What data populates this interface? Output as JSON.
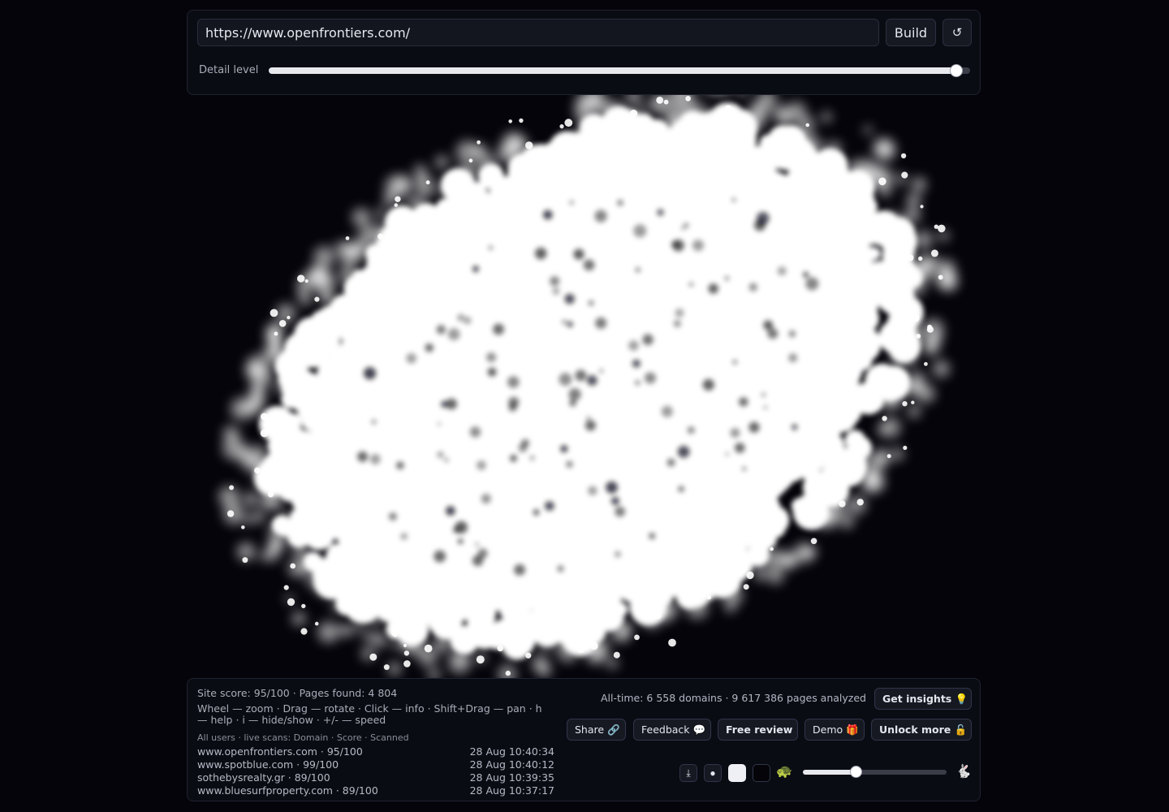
{
  "url_bar": {
    "value": "https://www.openfrontiers.com/",
    "build_label": "Build",
    "refresh_icon": "↺"
  },
  "detail": {
    "label": "Detail level",
    "value": 0.98
  },
  "stats": {
    "site_score": "Site score: 95/100 · Pages found: 4 804",
    "help": "Wheel — zoom · Drag — rotate · Click — info · Shift+Drag — pan · h — help · i — hide/show · +/- — speed",
    "scans_header": "All users · live scans: Domain · Score · Scanned",
    "scans": [
      {
        "domain": "www.openfrontiers.com · 95/100",
        "time": "28 Aug 10:40:34"
      },
      {
        "domain": "www.spotblue.com · 99/100",
        "time": "28 Aug 10:40:12"
      },
      {
        "domain": "sothebysrealty.gr · 89/100",
        "time": "28 Aug 10:39:35"
      },
      {
        "domain": "www.bluesurfproperty.com · 89/100",
        "time": "28 Aug 10:37:17"
      }
    ],
    "alltime": "All-time: 6 558 domains · 9 617 386 pages analyzed"
  },
  "actions": {
    "insights": "Get insights 💡",
    "share": "Share 🔗",
    "feedback": "Feedback 💬",
    "review": "Free review",
    "demo": "Demo 🎁",
    "unlock": "Unlock more 🔓"
  },
  "tools": {
    "download_icon": "⤓",
    "dot_icon": "●",
    "turtle_icon": "🐢",
    "rabbit_icon": "🐇",
    "speed": 0.37
  },
  "colors": {
    "background": "#04040a",
    "cloud": "#ffffff",
    "panel": "#0a0c13"
  }
}
